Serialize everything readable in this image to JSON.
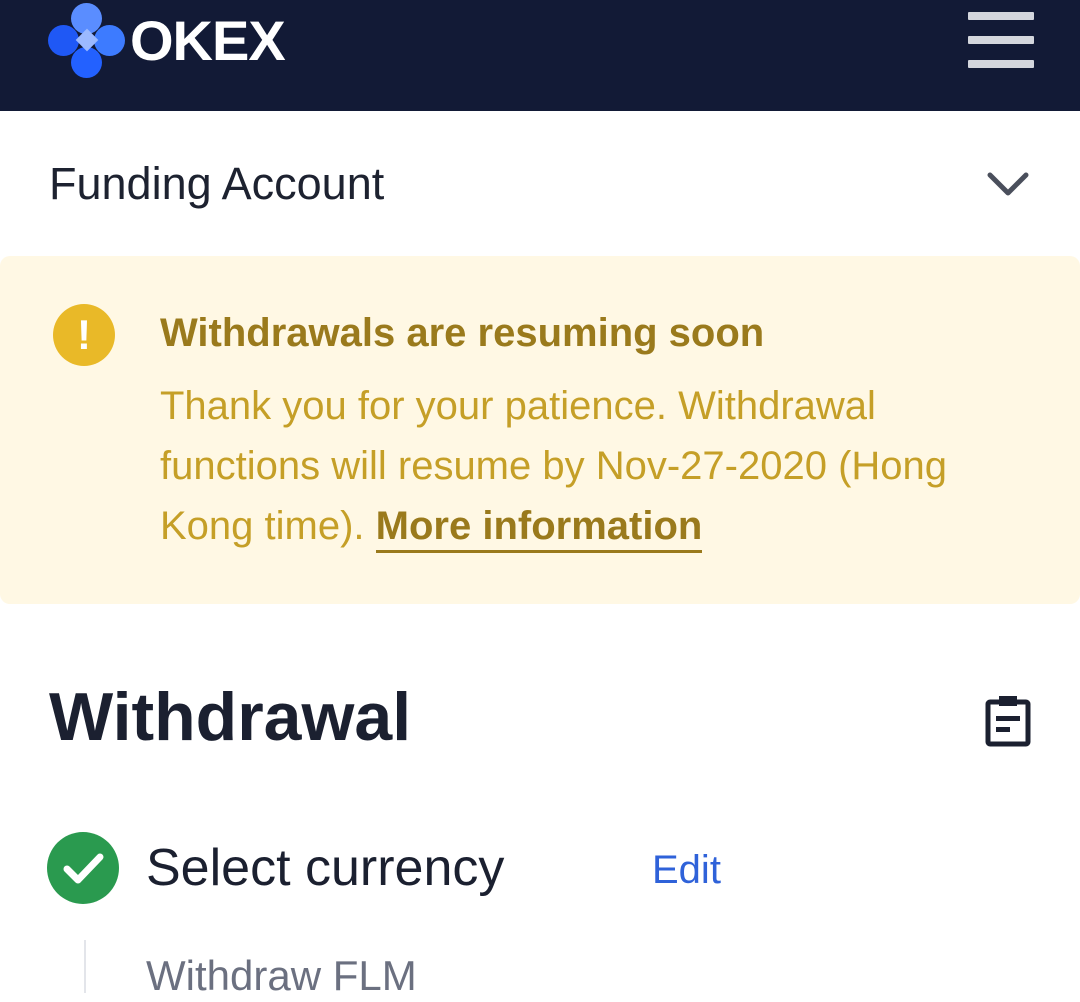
{
  "header": {
    "logo_text": "OKEX",
    "brand_color": "#2f6bff",
    "menu_icon": "hamburger-menu-icon"
  },
  "account": {
    "title": "Funding Account",
    "expand_icon": "chevron-down-icon"
  },
  "notice": {
    "icon": "exclamation-icon",
    "title": "Withdrawals are resuming soon",
    "body": "Thank you for your patience. Withdrawal functions will resume by Nov-27-2020 (Hong Kong time). ",
    "link_label": "More information",
    "background_color": "#fff8e4",
    "accent_color": "#e9b928"
  },
  "withdrawal": {
    "title": "Withdrawal",
    "history_icon": "record-clipboard-icon",
    "step": {
      "status_icon": "check-icon",
      "status_color": "#2a9a4f",
      "title": "Select currency",
      "edit_label": "Edit",
      "subtitle": "Withdraw FLM"
    }
  }
}
